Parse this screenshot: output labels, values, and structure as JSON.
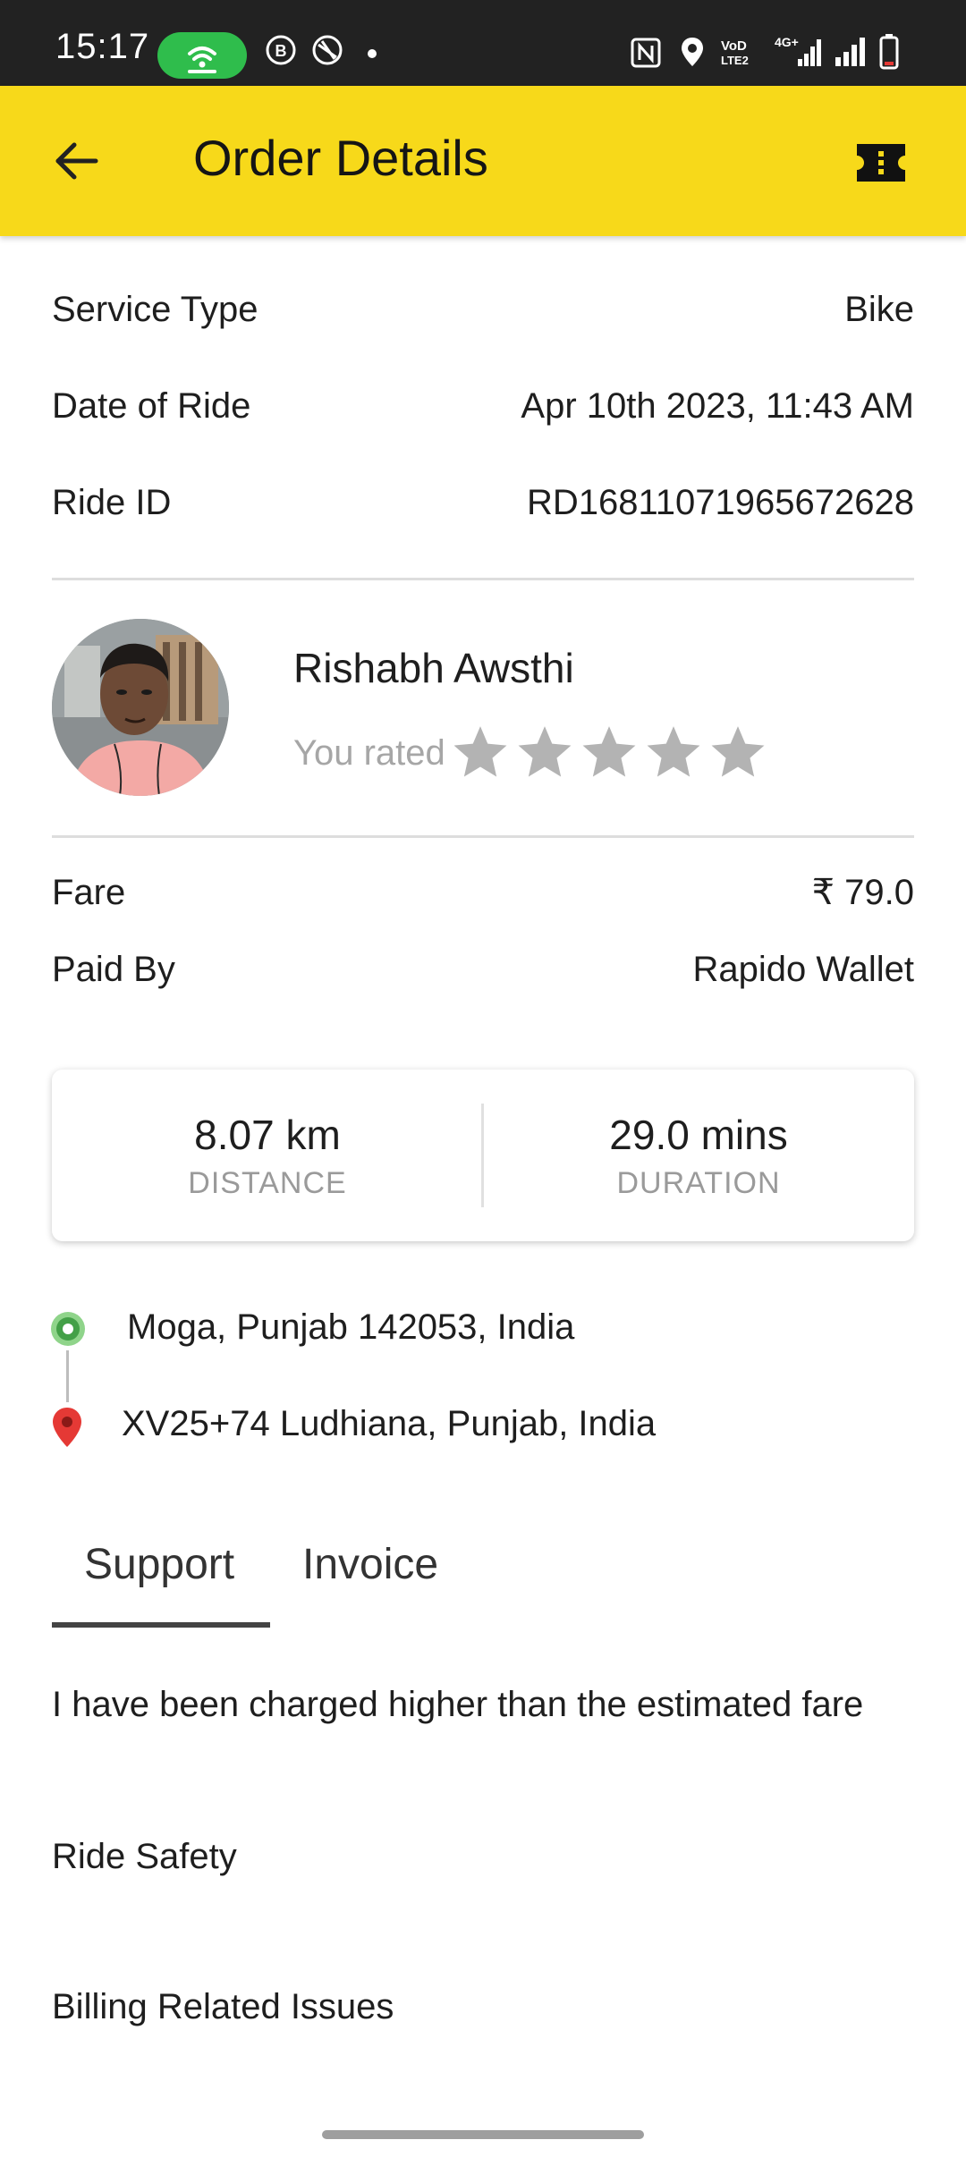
{
  "status_bar": {
    "time": "15:17"
  },
  "app_bar": {
    "title": "Order Details"
  },
  "ride_info": {
    "service_type_label": "Service Type",
    "service_type_value": "Bike",
    "date_label": "Date of Ride",
    "date_value": "Apr 10th 2023, 11:43 AM",
    "ride_id_label": "Ride ID",
    "ride_id_value": "RD16811071965672628"
  },
  "driver": {
    "name": "Rishabh Awsthi",
    "rated_label": "You rated",
    "rating": 0,
    "max_rating": 5
  },
  "payment": {
    "fare_label": "Fare",
    "fare_value": "₹ 79.0",
    "paid_by_label": "Paid By",
    "paid_by_value": "Rapido Wallet"
  },
  "trip": {
    "distance_value": "8.07 km",
    "distance_label": "DISTANCE",
    "duration_value": "29.0 mins",
    "duration_label": "DURATION"
  },
  "locations": {
    "pickup": "Moga, Punjab 142053, India",
    "drop": "XV25+74 Ludhiana, Punjab, India"
  },
  "tabs": [
    {
      "label": "Support",
      "active": true
    },
    {
      "label": "Invoice",
      "active": false
    }
  ],
  "support_items": [
    "I have been charged higher than the estimated fare",
    "Ride Safety",
    "Billing Related Issues"
  ],
  "colors": {
    "app_bar": "#f7d91a",
    "status_bar": "#222222",
    "pickup_pin": "#4caf50",
    "drop_pin": "#e53935",
    "star_inactive": "#b3b3b3"
  },
  "icons": {
    "back": "arrow-left-icon",
    "ticket": "ticket-icon",
    "pickup": "pickup-pin-icon",
    "drop": "drop-pin-icon",
    "star": "star-icon"
  }
}
